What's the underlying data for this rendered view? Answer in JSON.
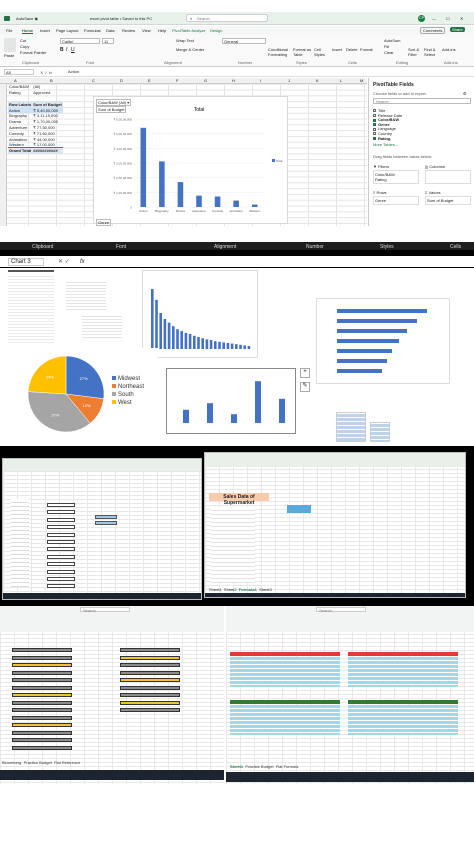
{
  "panel1": {
    "title": "excel pivot table • Saved to this PC",
    "search_placeholder": "Search",
    "user_initials": "CP",
    "comments_label": "Comments",
    "share_label": "Share",
    "menu": [
      "File",
      "Home",
      "Insert",
      "Page Layout",
      "Formulas",
      "Data",
      "Review",
      "View",
      "Help",
      "PivotTable Analyze",
      "Design"
    ],
    "ribbon": {
      "paste": "Paste",
      "cut": "Cut",
      "copy": "Copy",
      "format_painter": "Format Painter",
      "font": "Calibri",
      "font_size": "11",
      "wrap": "Wrap Text",
      "merge": "Merge & Center",
      "number_format": "General",
      "cond": "Conditional Formatting",
      "format_as": "Format as Table",
      "cell_styles": "Cell Styles",
      "insert": "Insert",
      "delete": "Delete",
      "format": "Format",
      "autosum": "AutoSum",
      "fill": "Fill",
      "clear": "Clear",
      "sort": "Sort & Filter",
      "find": "Find & Select",
      "addins": "Add-ins",
      "groups": [
        "Clipboard",
        "Font",
        "Alignment",
        "Number",
        "Styles",
        "Cells",
        "Editing",
        "Add-ins"
      ]
    },
    "name_box": "A5",
    "formula": "Action",
    "columns": [
      "A",
      "B",
      "C",
      "D",
      "E",
      "F",
      "G",
      "H",
      "I",
      "J",
      "K",
      "L",
      "M"
    ],
    "filters": [
      [
        "Color/B&W",
        "(All)"
      ],
      [
        "Rating",
        "Approved"
      ]
    ],
    "pivot_headers": [
      "Row Labels",
      "Sum of Budget"
    ],
    "pivot_rows": [
      [
        "Action",
        "₹ 5,40,00,000"
      ],
      [
        "Biography",
        "₹ 3,11,15,000"
      ],
      [
        "Drama",
        "₹ 1,70,00,000"
      ],
      [
        "Adventure",
        "₹ 77,50,000"
      ],
      [
        "Comedy",
        "₹ 71,60,000"
      ],
      [
        "Animation",
        "₹ 44,00,000"
      ],
      [
        "Western",
        "₹ 17,00,000"
      ]
    ],
    "grand_total": "Grand Total",
    "grand_total_value": "###########",
    "chart_labels": {
      "field1": "Color/B&W",
      "field1_val": "(All)",
      "field2": "Sum of Budget",
      "genre": "Genre"
    },
    "pivot_fields": {
      "title": "PivotTable Fields",
      "subtitle": "Choose fields to add to report:",
      "search": "Search",
      "fields": [
        [
          "Title",
          false
        ],
        [
          "Release Date",
          false
        ],
        [
          "Color/B&W",
          true
        ],
        [
          "Genre",
          true
        ],
        [
          "Language",
          false
        ],
        [
          "Country",
          false
        ],
        [
          "Rating",
          true
        ]
      ],
      "more": "More Tables...",
      "drag": "Drag fields between areas below:",
      "filters_label": "Filters",
      "filters": [
        "Color/B&W",
        "Rating"
      ],
      "columns_label": "Columns",
      "rows_label": "Rows",
      "rows": [
        "Genre"
      ],
      "values_label": "Values",
      "values": [
        "Sum of Budget"
      ]
    }
  },
  "chart_data": [
    {
      "type": "bar",
      "title": "Total",
      "categories": [
        "Action",
        "Biography",
        "Drama",
        "Adventure",
        "Comedy",
        "Animation",
        "Western"
      ],
      "values": [
        54000000,
        31115000,
        17000000,
        7750000,
        7160000,
        4400000,
        1700000
      ],
      "ylim": [
        0,
        60000000
      ],
      "yticks": [
        "0",
        "₹ 1,00,00,000",
        "₹ 2,00,00,000",
        "₹ 3,00,00,000",
        "₹ 4,00,00,000",
        "₹ 5,00,00,000",
        "₹ 6,00,00,000"
      ],
      "legend": "Total",
      "legend_position": "right"
    },
    {
      "type": "pie",
      "categories": [
        "Midwest",
        "Northeast",
        "South",
        "West"
      ],
      "values": [
        27,
        12,
        37,
        24
      ],
      "data_labels": [
        "27%",
        "12%",
        "37%",
        "24%"
      ],
      "colors": [
        "#4472c4",
        "#ed7d31",
        "#a5a5a5",
        "#ffc000"
      ],
      "legend_position": "right"
    }
  ],
  "panel2": {
    "ribbon_groups": [
      "Clipboard",
      "Font",
      "Alignment",
      "Number",
      "Styles",
      "Cells"
    ],
    "name_box": "Chart 3",
    "fx": "fx"
  },
  "panel3": {
    "sales_title": "Sales Data of Supermarket",
    "sheet_tabs": [
      "Sheet1",
      "Sheet2",
      "Formula1",
      "Sheet3"
    ]
  },
  "panel4": {
    "search": "Search",
    "sheet_tabs_left": [
      "Bloomberg",
      "Practice Budget",
      "Flat Reference"
    ],
    "sheet_tabs_right": [
      "Sheet1",
      "Practice Budget",
      "Flat Formula"
    ]
  }
}
